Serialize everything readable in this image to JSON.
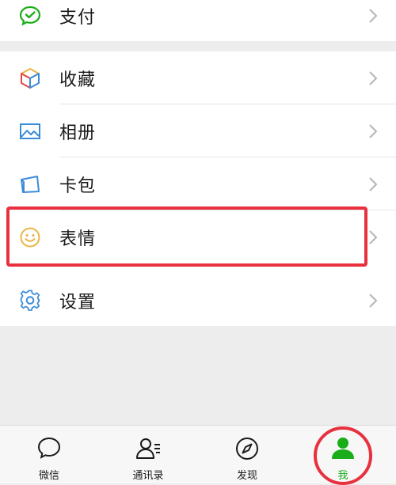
{
  "menu": {
    "pay": {
      "label": "支付",
      "icon": "wechat-pay-icon"
    },
    "favorites": {
      "label": "收藏",
      "icon": "cube-icon"
    },
    "album": {
      "label": "相册",
      "icon": "picture-icon"
    },
    "cards": {
      "label": "卡包",
      "icon": "wallet-icon"
    },
    "stickers": {
      "label": "表情",
      "icon": "smiley-icon"
    },
    "settings": {
      "label": "设置",
      "icon": "gear-icon"
    }
  },
  "tabbar": {
    "chats": {
      "label": "微信",
      "icon": "chat-bubble-icon"
    },
    "contacts": {
      "label": "通讯录",
      "icon": "contacts-icon"
    },
    "discover": {
      "label": "发现",
      "icon": "compass-icon"
    },
    "me": {
      "label": "我",
      "icon": "person-icon",
      "active": true
    }
  },
  "colors": {
    "brand_green": "#1aad19",
    "highlight_red": "#e8303f",
    "background": "#ededed"
  }
}
